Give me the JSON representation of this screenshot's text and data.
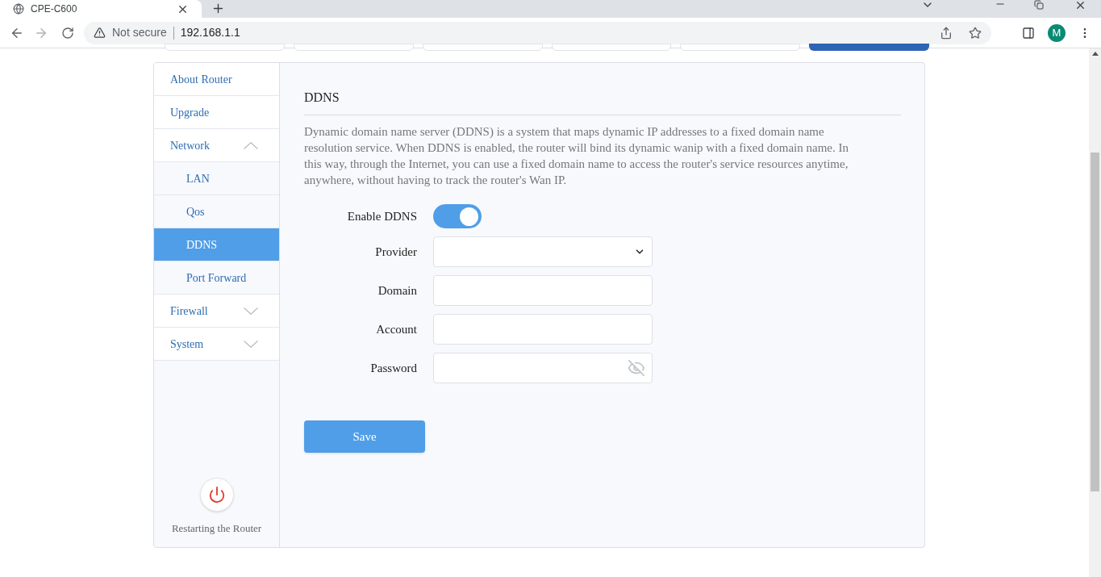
{
  "browser": {
    "tab_title": "CPE-C600",
    "security": "Not secure",
    "url": "192.168.1.1",
    "avatar": "M"
  },
  "top_nav": [
    {
      "selected": false
    },
    {
      "selected": false
    },
    {
      "selected": false
    },
    {
      "selected": false
    },
    {
      "selected": false
    },
    {
      "selected": true
    }
  ],
  "sidebar": {
    "items": [
      {
        "kind": "link",
        "label": "About Router",
        "selected": false
      },
      {
        "kind": "link",
        "label": "Upgrade",
        "selected": false
      },
      {
        "kind": "group",
        "label": "Network",
        "selected": false,
        "expanded": true,
        "children": [
          {
            "label": "LAN",
            "selected": false
          },
          {
            "label": "Qos",
            "selected": false
          },
          {
            "label": "DDNS",
            "selected": true
          },
          {
            "label": "Port Forward",
            "selected": false
          }
        ]
      },
      {
        "kind": "group",
        "label": "Firewall",
        "selected": false,
        "expanded": false
      },
      {
        "kind": "group",
        "label": "System",
        "selected": false,
        "expanded": false
      }
    ],
    "restart_label": "Restarting the Router"
  },
  "section": {
    "title": "DDNS",
    "description": "Dynamic domain name server (DDNS) is a system that maps dynamic IP addresses to a fixed domain name resolution service. When DDNS is enabled, the router will bind its dynamic wanip with a fixed domain name. In this way, through the Internet, you can use a fixed domain name to access the router's service resources anytime, anywhere, without having to track the router's Wan IP."
  },
  "form": {
    "fields": [
      {
        "kind": "toggle",
        "label": "Enable DDNS",
        "on": true
      },
      {
        "kind": "select",
        "label": "Provider"
      },
      {
        "kind": "text",
        "label": "Domain"
      },
      {
        "kind": "text",
        "label": "Account"
      },
      {
        "kind": "password",
        "label": "Password"
      }
    ]
  },
  "save_button": "Save"
}
